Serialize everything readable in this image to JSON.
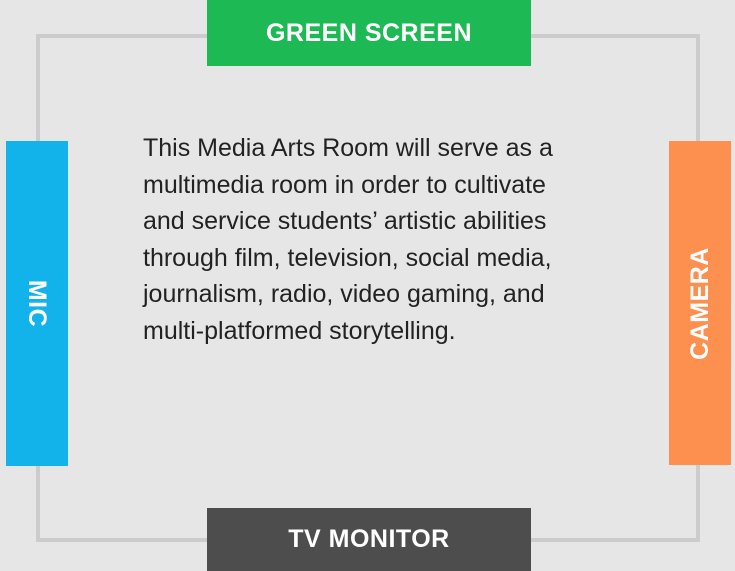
{
  "labels": {
    "top": "GREEN SCREEN",
    "bottom": "TV MONITOR",
    "left": "MIC",
    "right": "CAMERA"
  },
  "description": "This Media Arts Room will serve as a multimedia room in order to cultivate and service students’ artistic abilities through film, television, social media, journalism, radio, video gaming, and multi-platformed storytelling.",
  "colors": {
    "background": "#e6e6e6",
    "frame": "#cccccc",
    "green_screen": "#1db954",
    "tv_monitor": "#4d4d4d",
    "mic": "#12b3ea",
    "camera": "#fd8f4f",
    "text": "#222222"
  }
}
